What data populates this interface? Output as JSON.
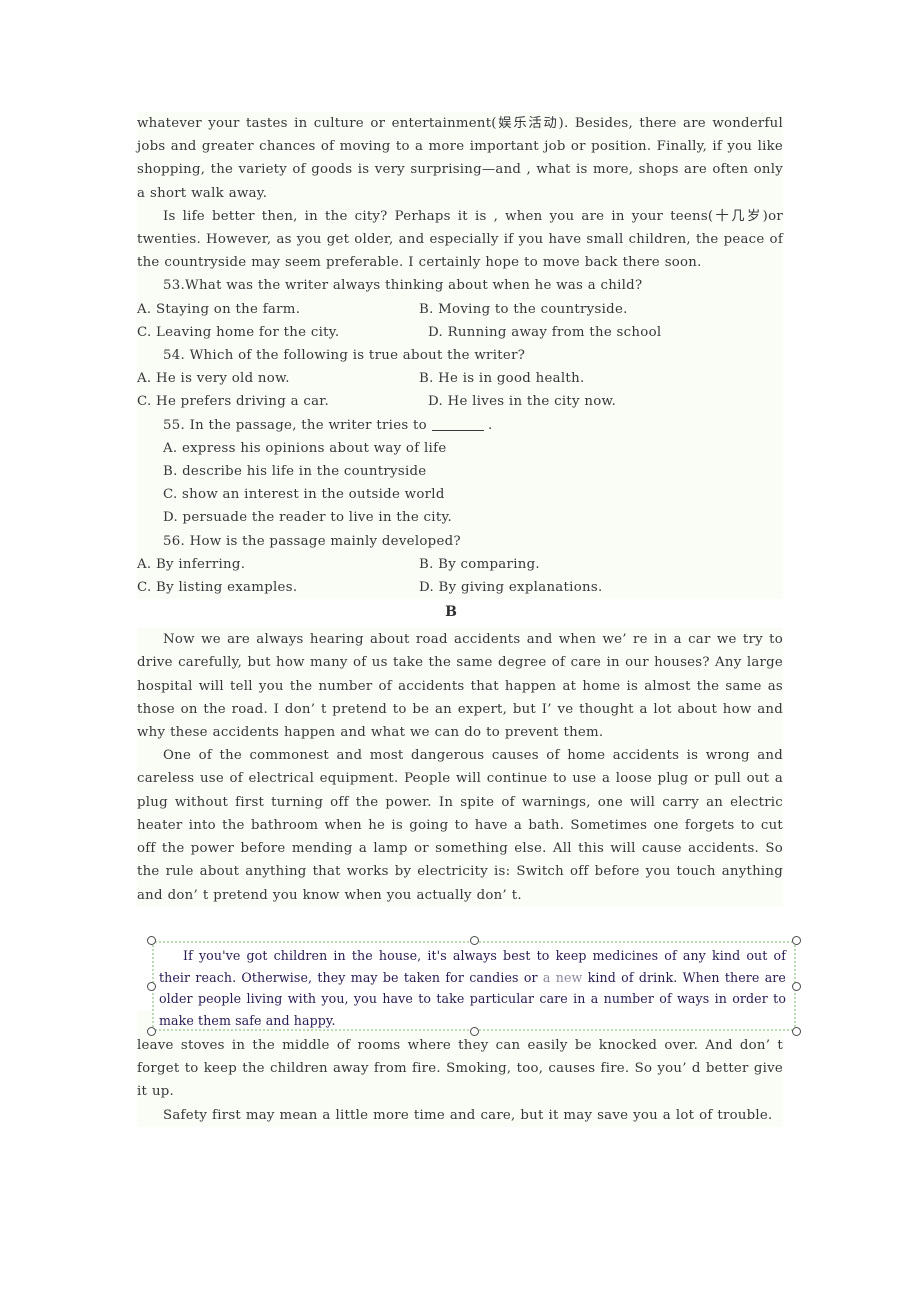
{
  "page": {
    "background_color": "#ffffff",
    "text_color": "#36363a",
    "text_tint_color": "#fafcf6"
  },
  "passage_a": {
    "continuation_paragraph": "whatever your tastes in culture or entertainment(娱乐活动). Besides, there are wonderful jobs and greater chances of moving to a more important job or position. Finally, if you like shopping, the variety of goods is very surprising—and , what is more, shops are often only a short walk away.",
    "closing_paragraph": "Is life better then, in the city? Perhaps it is , when you are in your teens(十几岁)or twenties. However, as you get older, and especially if you have small children, the peace of the countryside may seem preferable. I certainly hope to move back there soon."
  },
  "questions": [
    {
      "number": "53.",
      "stem": "53.What was the writer always thinking about when he was a child?",
      "rows": [
        {
          "left": "A. Staying on the farm.",
          "right": "B. Moving to the countryside."
        },
        {
          "left": "C. Leaving home for the city.",
          "right": "  D. Running away from the school"
        }
      ]
    },
    {
      "number": "54.",
      "stem": "54. Which of the following is true about the writer?",
      "rows": [
        {
          "left": "A. He is very old now.",
          "right": "B. He is in good health."
        },
        {
          "left": "C. He prefers driving a car.",
          "right": "  D. He lives in the city now."
        }
      ]
    },
    {
      "number": "55.",
      "stem_prefix": "55. In the passage, the writer tries to ",
      "stem_suffix": " .",
      "stacked_options": [
        "A. express his opinions about way of life",
        "B. describe his life in the countryside",
        "C. show an interest in the outside world",
        "D. persuade the reader to live in the city."
      ]
    },
    {
      "number": "56.",
      "stem": "56. How is the passage mainly developed?",
      "rows": [
        {
          "left": "A. By inferring.",
          "right": "B. By comparing."
        },
        {
          "left": "C. By listing examples.",
          "right": "D. By giving explanations."
        }
      ]
    }
  ],
  "section_b": {
    "letter": "B",
    "paragraph_1": "Now we are always hearing about road accidents and when we’ re in a car we try to drive carefully, but how many of us take the same degree of care in our houses? Any large hospital will tell you the number of accidents that happen at home is almost the same as those on the road. I don’ t pretend to be an expert, but I’ ve thought a lot about how and why these accidents happen and what we can do to prevent them.",
    "paragraph_2": "One of the commonest and most dangerous causes of home accidents is wrong and careless use of electrical equipment. People will continue to use a loose plug or pull out a plug without first turning off the power. In spite of warnings, one will carry an electric heater into the bathroom when he is going to have a bath. Sometimes one forgets to cut off the power before mending a lamp or something else. All this will cause accidents. So the rule about anything that works by electricity is: Switch off before you touch anything and don’ t pretend you know when you actually don’ t.",
    "paragraph_4": "Fire, of course, is always a risk. So, remember not to dry clothes in front of fires, or leave stoves in the middle of rooms where they can easily be knocked over. And don’ t forget to keep the children away from fire. Smoking, too, causes fire. So you’ d better give it up.",
    "paragraph_5": "Safety first may mean a little more time and care, but it may save you a lot of trouble."
  },
  "selected_textbox": {
    "state": "selected",
    "border_color": "#b9dcb0",
    "text_color": "#2a1a52",
    "handle_fill": "#ffffff",
    "handle_stroke": "#4a4a4a",
    "text_part_1": "If you've got children in the house, it's always best to keep medicines of any kind out of their reach. Otherwise, they may be taken for candies or ",
    "text_faded": "a new",
    "text_part_2": " kind of drink. When there are older people living with you, you have to take particular care in a number of ways in order to make them safe and happy."
  }
}
